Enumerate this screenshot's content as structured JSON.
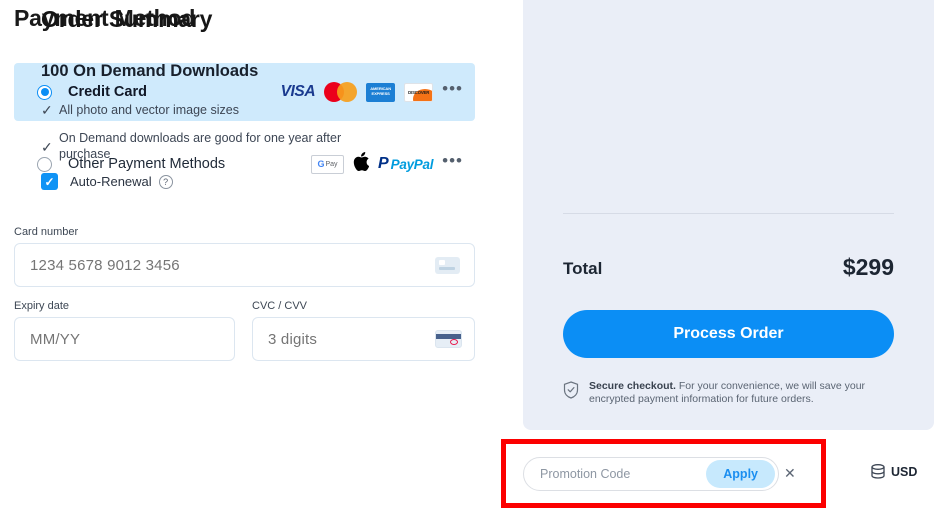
{
  "payment": {
    "title": "Payment Method",
    "methods": [
      {
        "label": "Credit Card",
        "selected": true,
        "brands": [
          "visa",
          "mastercard",
          "amex",
          "discover"
        ],
        "more_label": "•••"
      },
      {
        "label": "Other Payment Methods",
        "selected": false,
        "brands": [
          "google-pay",
          "apple-pay",
          "paypal"
        ],
        "more_label": "•••"
      }
    ],
    "brand_text": {
      "visa": "VISA",
      "amex_line1": "AMERICAN",
      "amex_line2": "EXPRESS",
      "discover": "DISCOVER",
      "gpay_g": "G",
      "gpay_pay": "Pay",
      "apple_glyph": "",
      "paypal_mark": "P",
      "paypal_text": "PayPal"
    },
    "fields": {
      "card_number": {
        "label": "Card number",
        "value": "",
        "placeholder": "1234 5678 9012 3456"
      },
      "expiry": {
        "label": "Expiry date",
        "value": "",
        "placeholder": "MM/YY"
      },
      "cvc": {
        "label": "CVC / CVV",
        "value": "",
        "placeholder": "3 digits"
      }
    }
  },
  "summary": {
    "title": "Order Summary",
    "plan_name": "100 On Demand Downloads",
    "features": [
      {
        "check": "✓",
        "text": "All photo and vector image sizes"
      },
      {
        "check": "✓",
        "text": "On Demand downloads are good for one year after purchase"
      }
    ],
    "auto_renewal": {
      "label": "Auto-Renewal",
      "checked": true,
      "check_glyph": "✓",
      "help_glyph": "?"
    },
    "total_label": "Total",
    "total_value": "$299",
    "process_order_label": "Process Order",
    "secure_note_bold": "Secure checkout.",
    "secure_note_rest": " For your convenience, we will save your encrypted payment information for future orders."
  },
  "footer": {
    "promotion": {
      "value": "",
      "placeholder": "Promotion Code",
      "apply_label": "Apply",
      "close_glyph": "✕"
    },
    "currency": {
      "label": "USD"
    }
  },
  "colors": {
    "accent_blue": "#0b8ef5",
    "panel_bg": "#eaeef7",
    "selected_row_bg": "#cfeafc",
    "highlight_red": "#fc0000",
    "apply_bg": "#c7e9fd"
  }
}
